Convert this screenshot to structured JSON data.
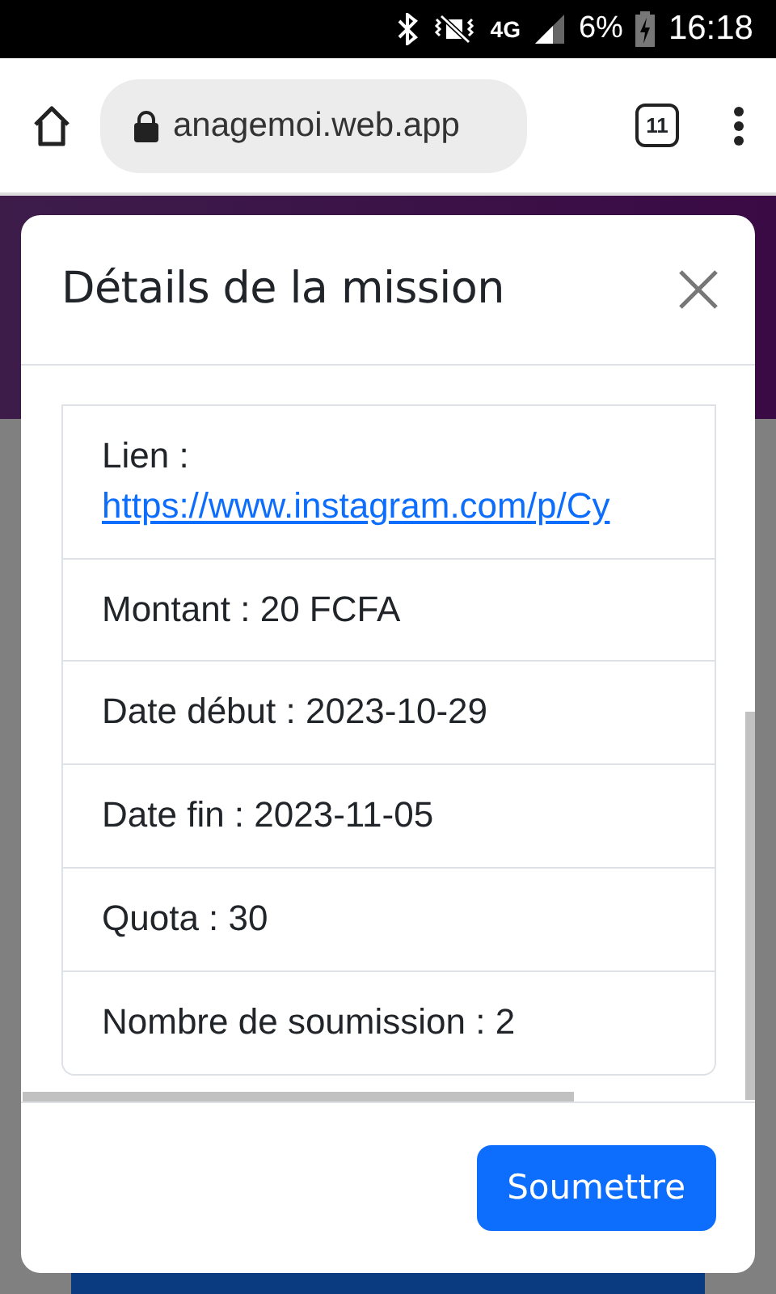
{
  "status_bar": {
    "network": "4G",
    "battery": "6%",
    "time": "16:18"
  },
  "browser": {
    "url": "anagemoi.web.app",
    "tab_count": "11"
  },
  "modal": {
    "title": "Détails de la mission",
    "rows": [
      {
        "kind": "link",
        "label": "Lien :",
        "link": "https://www.instagram.com/p/Cy"
      },
      {
        "kind": "text",
        "text": "Montant : 20 FCFA"
      },
      {
        "kind": "text",
        "text": "Date début : 2023-10-29"
      },
      {
        "kind": "text",
        "text": "Date fin : 2023-11-05"
      },
      {
        "kind": "text",
        "text": "Quota : 30"
      },
      {
        "kind": "text",
        "text": "Nombre de soumission : 2"
      }
    ],
    "submit_button": "Soumettre"
  }
}
